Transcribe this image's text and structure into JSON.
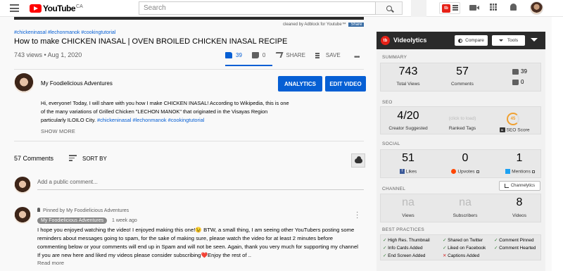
{
  "header": {
    "logo_text": "YouTube",
    "country_code": "CA",
    "search_placeholder": "Search"
  },
  "video": {
    "adblock_note": "cleaned by Adblock for Youtube™",
    "share_label": "Share",
    "hashtags": "#chickeninasal #lechonmanok #cookingtutorial",
    "title": "How to make CHICKEN INASAL | OVEN BROILED CHICKEN INASAL RECIPE",
    "views_date": "743 views • Aug 1, 2020",
    "likes": "39",
    "dislikes": "0",
    "share": "SHARE",
    "save": "SAVE",
    "like_ratio": 1.0
  },
  "channel": {
    "name": "My Foodielicious Adventures",
    "analytics_btn": "ANALYTICS",
    "edit_btn": "EDIT VIDEO"
  },
  "description": {
    "line1": "Hi, everyone! Today, I will share with you how I make CHICKEN INASAL! According to Wikipedia, this is one",
    "line2": "of the many variations of Grilled Chicken \"LECHON MANOK\" that originated in the Visayas Region",
    "line3_prefix": "particularly ILOILO City. ",
    "line3_tags": "#chickeninasal #lechonmanok #cookingtutorial",
    "show_more": "SHOW MORE"
  },
  "comments": {
    "count_label": "57 Comments",
    "sort_label": "SORT BY",
    "add_placeholder": "Add a public comment...",
    "pinned_label": "Pinned by My Foodielicious Adventures",
    "author": "My Foodielicious Adventures",
    "time": "1 week ago",
    "text": "I hope you enjoyed watching the video! I enjoyed making this one!😉 BTW, a small thing, I am seeing other YouTubers posting some reminders about messages going to spam, for the sake of making sure, please watch the video for at least 2 minutes before commenting below or your comments will end up in Spam and will not be seen. Again, thank you very much for supporting my channel If you are new here and liked my videos please consider subscribing❤️Enjoy the rest of ..",
    "read_more": "Read more"
  },
  "videolytics": {
    "title": "Videolytics",
    "badge": "tb",
    "compare_btn": "Compare",
    "tools_btn": "Tools",
    "summary": {
      "label": "SUMMARY",
      "total_views": "743",
      "total_views_label": "Total Views",
      "comments": "57",
      "comments_label": "Comments",
      "likes": "39",
      "dislikes": "0"
    },
    "seo": {
      "label": "SEO",
      "creator_suggested": "4/20",
      "creator_suggested_label": "Creator Suggested",
      "click_to_load": "(click to load)",
      "ranked_tags_label": "Ranked Tags",
      "seo_score": "45",
      "seo_score_label": "SEO Score"
    },
    "social": {
      "label": "SOCIAL",
      "likes": "51",
      "likes_label": "Likes",
      "upvotes": "0",
      "upvotes_label": "Upvotes",
      "mentions": "1",
      "mentions_label": "Mentions"
    },
    "channel": {
      "label": "CHANNEL",
      "channelytics_btn": "Channelytics",
      "views": "na",
      "views_label": "Views",
      "subscribers": "na",
      "subscribers_label": "Subscribers",
      "videos": "8",
      "videos_label": "Videos"
    },
    "best_practices": {
      "label": "BEST PRACTICES",
      "items": [
        "High Res. Thumbnail",
        "Shared on Twitter",
        "Comment Pinned",
        "Info Cards Added",
        "Liked on Facebook",
        "Comment Hearted",
        "End Screen Added",
        "Captions Added"
      ]
    }
  },
  "colors": {
    "accent": "#065fd4",
    "yt_red": "#ff0000",
    "vl_header": "#2b2b2b"
  }
}
